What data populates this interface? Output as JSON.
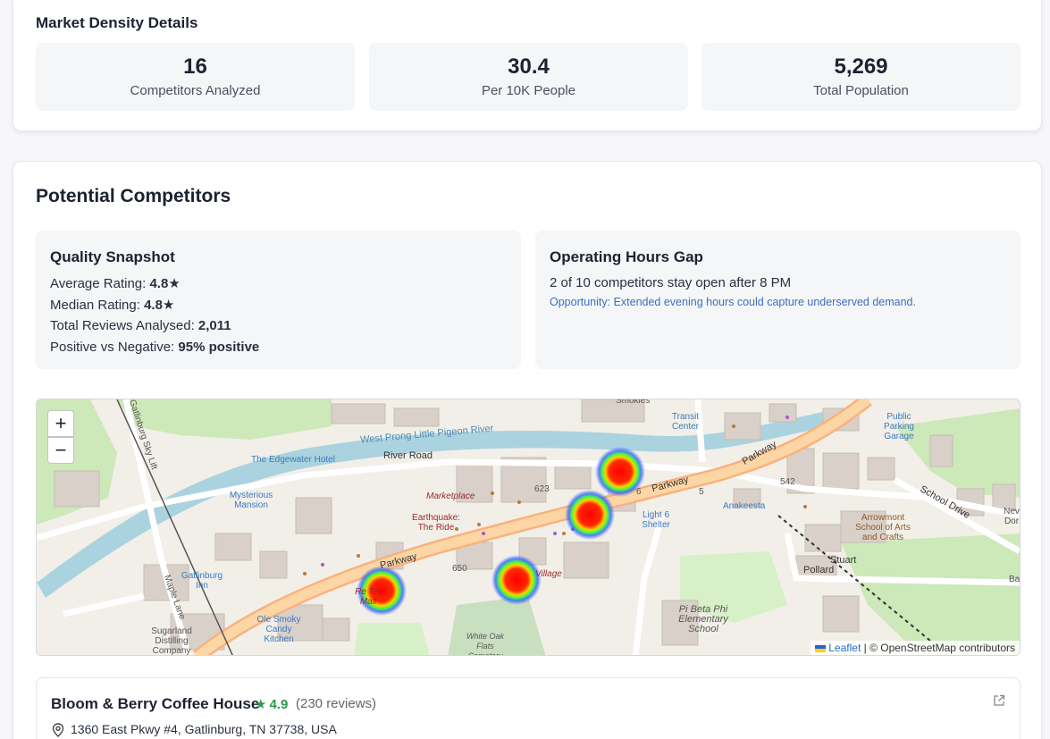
{
  "density": {
    "title": "Market Density Details",
    "stats": [
      {
        "value": "16",
        "label": "Competitors Analyzed"
      },
      {
        "value": "30.4",
        "label": "Per 10K People"
      },
      {
        "value": "5,269",
        "label": "Total Population"
      }
    ]
  },
  "competitors": {
    "title": "Potential Competitors",
    "quality": {
      "title": "Quality Snapshot",
      "avg_label": "Average Rating:",
      "avg_value": "4.8★",
      "median_label": "Median Rating:",
      "median_value": "4.8★",
      "reviews_label": "Total Reviews Analysed:",
      "reviews_value": "2,011",
      "sentiment_label": "Positive vs Negative:",
      "sentiment_value": "95% positive"
    },
    "hours": {
      "title": "Operating Hours Gap",
      "text": "2 of 10 competitors stay open after 8 PM",
      "opportunity": "Opportunity: Extended evening hours could capture underserved demand."
    }
  },
  "map": {
    "zoom_in": "+",
    "zoom_out": "−",
    "attribution_leaflet": "Leaflet",
    "attribution_rest": "| © OpenStreetMap contributors",
    "labels": {
      "river_road": "River Road",
      "river": "West Prong Little Pigeon River",
      "parkway": "Parkway",
      "parkway2": "Parkway",
      "parkway3": "Parkway",
      "edgewater": "The Edgewater Hotel",
      "mysterious": "Mysterious Mansion",
      "marketplace": "Marketplace",
      "earthquake": "Earthquake: The Ride",
      "gatlinburg_inn": "Gatlinburg Inn",
      "ole_smoky": "Ole Smoky Candy Kitchen",
      "sugarland": "Sugarland Distilling Company",
      "maple": "Maple Lane",
      "sky_lift": "Gatlinburg Sky Lift",
      "transit": "Transit Center",
      "light6": "Light 6 Shelter",
      "anakeesta": "Anakeesta",
      "public_parking": "Public Parking Garage",
      "school_drive": "School Drive",
      "arrowmont": "Arrowmont School of Arts and Crafts",
      "stuart": "Stuart",
      "pollard": "Pollard",
      "pi_beta": "Pi Beta Phi Elementary School",
      "white_oak": "White Oak Flats Cemetery",
      "village": "Village",
      "n623": "623",
      "n650": "650",
      "n542": "542",
      "n5": "5",
      "n6": "6",
      "smokies": "Smokies",
      "nev": "Nev Dor",
      "ba": "Ba",
      "reagan": "Re Ter Mall"
    }
  },
  "business": {
    "name": "Bloom & Berry Coffee House",
    "rating": "4.9",
    "reviews": "(230 reviews)",
    "address": "1360 East Pkwy #4, Gatlinburg, TN 37738, USA"
  }
}
